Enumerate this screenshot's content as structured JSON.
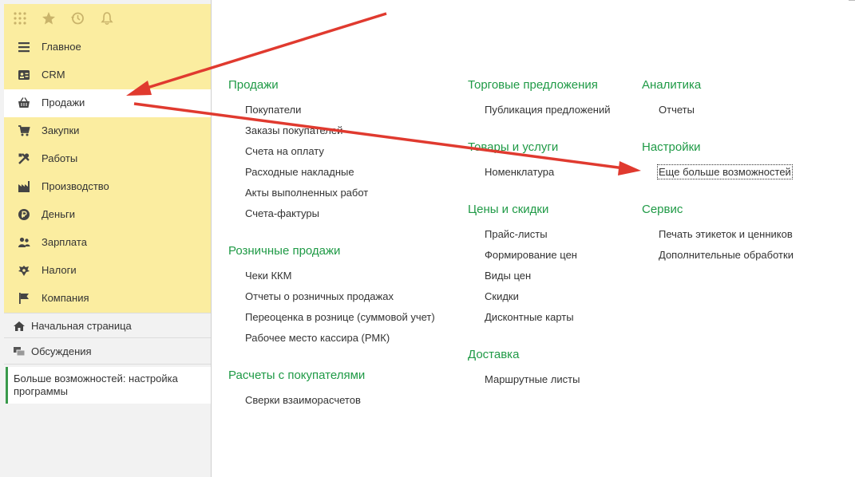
{
  "toolbar": {
    "icons": [
      "apps-grid-icon",
      "star-icon",
      "history-icon",
      "bell-icon"
    ]
  },
  "sections": [
    {
      "label": "Главное",
      "icon": "menu-lines-icon"
    },
    {
      "label": "CRM",
      "icon": "contact-card-icon"
    },
    {
      "label": "Продажи",
      "icon": "basket-icon",
      "active": true
    },
    {
      "label": "Закупки",
      "icon": "cart-icon"
    },
    {
      "label": "Работы",
      "icon": "tools-icon"
    },
    {
      "label": "Производство",
      "icon": "factory-icon"
    },
    {
      "label": "Деньги",
      "icon": "ruble-coin-icon"
    },
    {
      "label": "Зарплата",
      "icon": "people-icon"
    },
    {
      "label": "Налоги",
      "icon": "eagle-emblem-icon"
    },
    {
      "label": "Компания",
      "icon": "flag-icon"
    }
  ],
  "home": {
    "label": "Начальная страница",
    "icon": "home-icon"
  },
  "discussions": {
    "label": "Обсуждения",
    "icon": "chat-icon"
  },
  "open_window": {
    "label": "Больше возможностей: настройка программы"
  },
  "groups": {
    "sales": {
      "title": "Продажи",
      "links": [
        "Покупатели",
        "Заказы покупателей",
        "Счета на оплату",
        "Расходные накладные",
        "Акты выполненных работ",
        "Счета-фактуры"
      ]
    },
    "retail": {
      "title": "Розничные продажи",
      "links": [
        "Чеки ККМ",
        "Отчеты о розничных продажах",
        "Переоценка в рознице (суммовой учет)",
        "Рабочее место кассира (РМК)"
      ]
    },
    "settlements": {
      "title": "Расчеты с покупателями",
      "links": [
        "Сверки взаиморасчетов"
      ]
    },
    "offers": {
      "title": "Торговые предложения",
      "links": [
        "Публикация предложений"
      ]
    },
    "goods": {
      "title": "Товары и услуги",
      "links": [
        "Номенклатура"
      ]
    },
    "prices": {
      "title": "Цены и скидки",
      "links": [
        "Прайс-листы",
        "Формирование цен",
        "Виды цен",
        "Скидки",
        "Дисконтные карты"
      ]
    },
    "delivery": {
      "title": "Доставка",
      "links": [
        "Маршрутные листы"
      ]
    },
    "analytics": {
      "title": "Аналитика",
      "links": [
        "Отчеты"
      ]
    },
    "settings": {
      "title": "Настройки",
      "links": [
        "Еще больше возможностей"
      ]
    },
    "service": {
      "title": "Сервис",
      "links": [
        "Печать этикеток и ценников",
        "Дополнительные обработки"
      ]
    }
  },
  "colors": {
    "section_bg": "#fbeda0",
    "group_title": "#1f9a46",
    "annotation_arrow": "#e03a2f"
  }
}
